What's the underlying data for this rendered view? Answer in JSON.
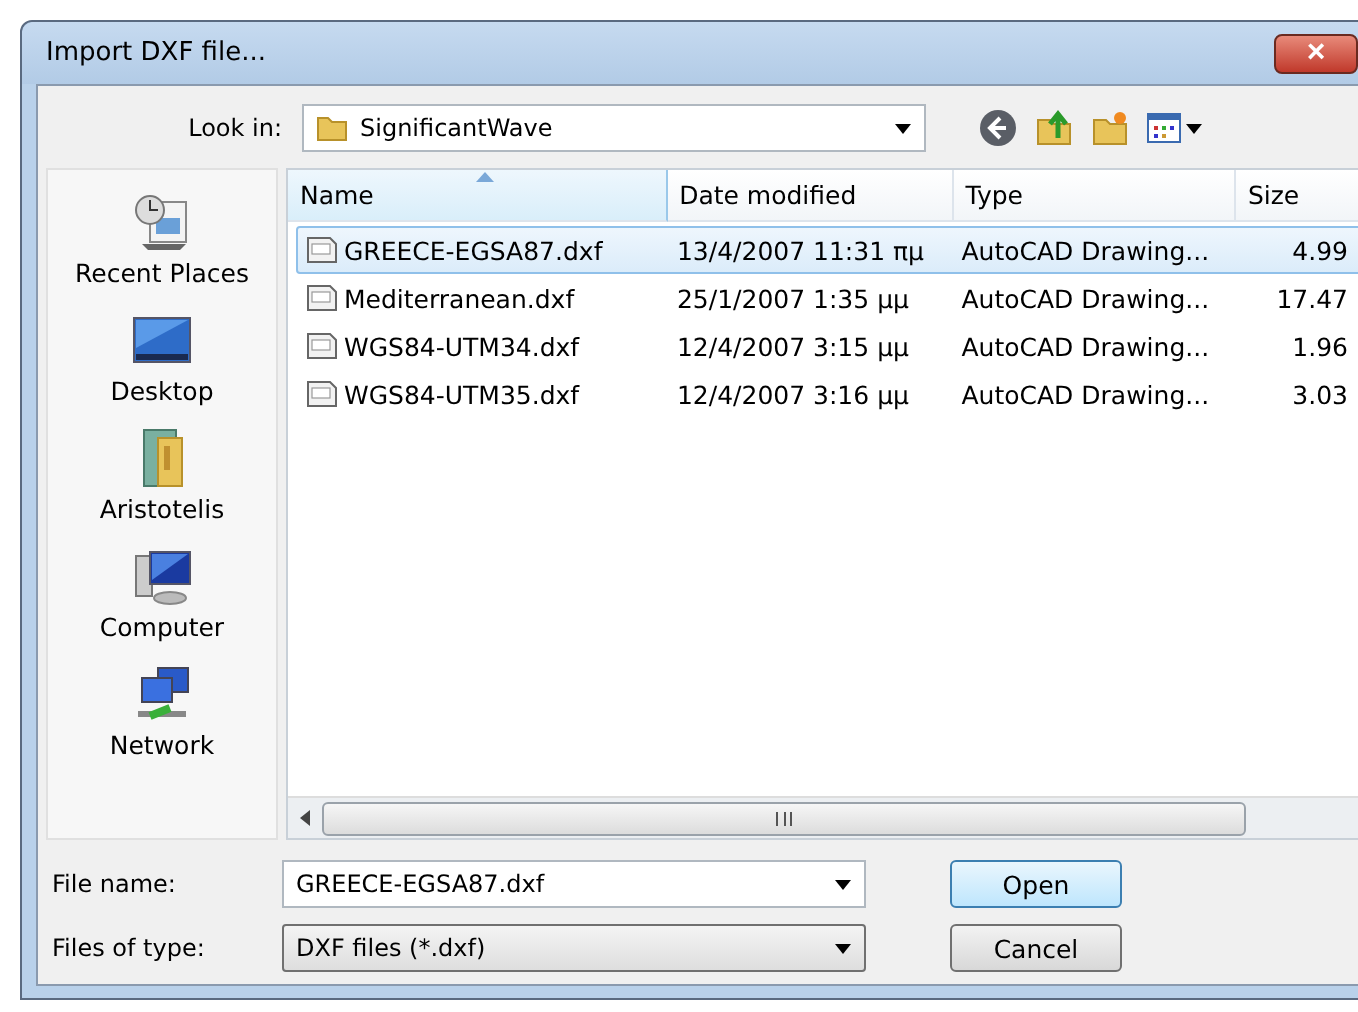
{
  "window": {
    "title": "Import DXF file...",
    "close": "×"
  },
  "look_in": {
    "label": "Look in:",
    "value": "SignificantWave"
  },
  "sidebar": {
    "items": [
      {
        "label": "Recent Places",
        "kind": "recent"
      },
      {
        "label": "Desktop",
        "kind": "desktop"
      },
      {
        "label": "Aristotelis",
        "kind": "user"
      },
      {
        "label": "Computer",
        "kind": "computer"
      },
      {
        "label": "Network",
        "kind": "network"
      }
    ]
  },
  "table": {
    "columns": [
      {
        "label": "Name",
        "sorted": true
      },
      {
        "label": "Date modified",
        "sorted": false
      },
      {
        "label": "Type",
        "sorted": false
      },
      {
        "label": "Size",
        "sorted": false
      }
    ],
    "rows": [
      {
        "name": "GREECE-EGSA87.dxf",
        "date": "13/4/2007 11:31 πμ",
        "type": "AutoCAD Drawing...",
        "size": "4.99",
        "selected": true
      },
      {
        "name": "Mediterranean.dxf",
        "date": "25/1/2007 1:35 μμ",
        "type": "AutoCAD Drawing...",
        "size": "17.47",
        "selected": false
      },
      {
        "name": "WGS84-UTM34.dxf",
        "date": "12/4/2007 3:15 μμ",
        "type": "AutoCAD Drawing...",
        "size": "1.96",
        "selected": false
      },
      {
        "name": "WGS84-UTM35.dxf",
        "date": "12/4/2007 3:16 μμ",
        "type": "AutoCAD Drawing...",
        "size": "3.03",
        "selected": false
      }
    ]
  },
  "file_name": {
    "label": "File name:",
    "value": "GREECE-EGSA87.dxf"
  },
  "file_type": {
    "label": "Files of type:",
    "value": "DXF files (*.dxf)"
  },
  "buttons": [
    {
      "label": "Open",
      "default": true
    },
    {
      "label": "Cancel",
      "default": false
    }
  ]
}
